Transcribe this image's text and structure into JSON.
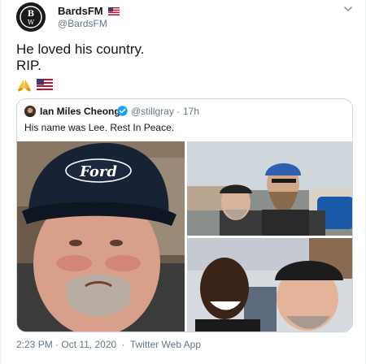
{
  "tweet": {
    "author": {
      "name": "BardsFM",
      "handle": "@BardsFM",
      "flag_icon": "us-flag-icon"
    },
    "text_lines": [
      "He loved his country.",
      "RIP."
    ],
    "emojis": [
      "folded-hands-icon",
      "us-flag-icon"
    ],
    "quoted": {
      "name": "Ian Miles Cheong",
      "verified": true,
      "handle": "@stillgray",
      "separator": "·",
      "time": "17h",
      "text": "His name was Lee. Rest In Peace.",
      "cap_text": "Ford"
    },
    "timestamp": "2:23 PM · Oct 11, 2020",
    "separator": "·",
    "source": "Twitter Web App"
  },
  "colors": {
    "text": "#14171a",
    "secondary": "#657786",
    "border": "#ccd6dd",
    "verified": "#1da1f2"
  }
}
